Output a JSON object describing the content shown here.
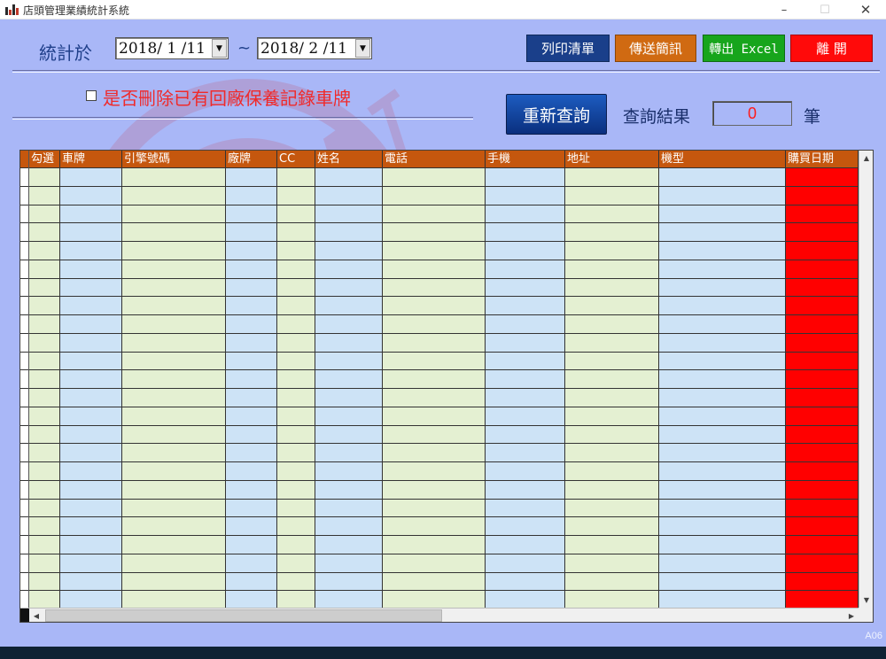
{
  "window": {
    "title": "店頭管理業績統計系統",
    "controls": {
      "minimize": "–",
      "maximize": "☐",
      "close": "✕"
    },
    "version": "A06"
  },
  "filters": {
    "period_label": "統計於",
    "date_from": "2018/ 1 /11",
    "separator": "~",
    "date_to": "2018/ 2 /11",
    "delete_checkbox_label": "是否刪除已有回廠保養記錄車牌",
    "delete_checked": false
  },
  "toolbar": {
    "print_label": "列印清單",
    "sms_label": "傳送簡訊",
    "excel_label": "轉出 Excel",
    "exit_label": "離 開"
  },
  "query": {
    "requery_label": "重新查詢",
    "result_label": "查詢結果",
    "result_count": "0",
    "unit_label": "筆"
  },
  "table": {
    "columns": [
      "勾選",
      "車牌",
      "引擎號碼",
      "廠牌",
      "CC",
      "姓名",
      "電話",
      "手機",
      "地址",
      "機型",
      "購買日期"
    ],
    "rows": []
  },
  "colors": {
    "background": "#a9b7f7",
    "header": "#c5570e",
    "print_button": "#1a3f8a",
    "sms_button": "#d06a12",
    "excel_button": "#17a51c",
    "exit_button": "#ff0a0a",
    "purchase_date_column": "#ff0000"
  },
  "watermark_text": "NEW"
}
